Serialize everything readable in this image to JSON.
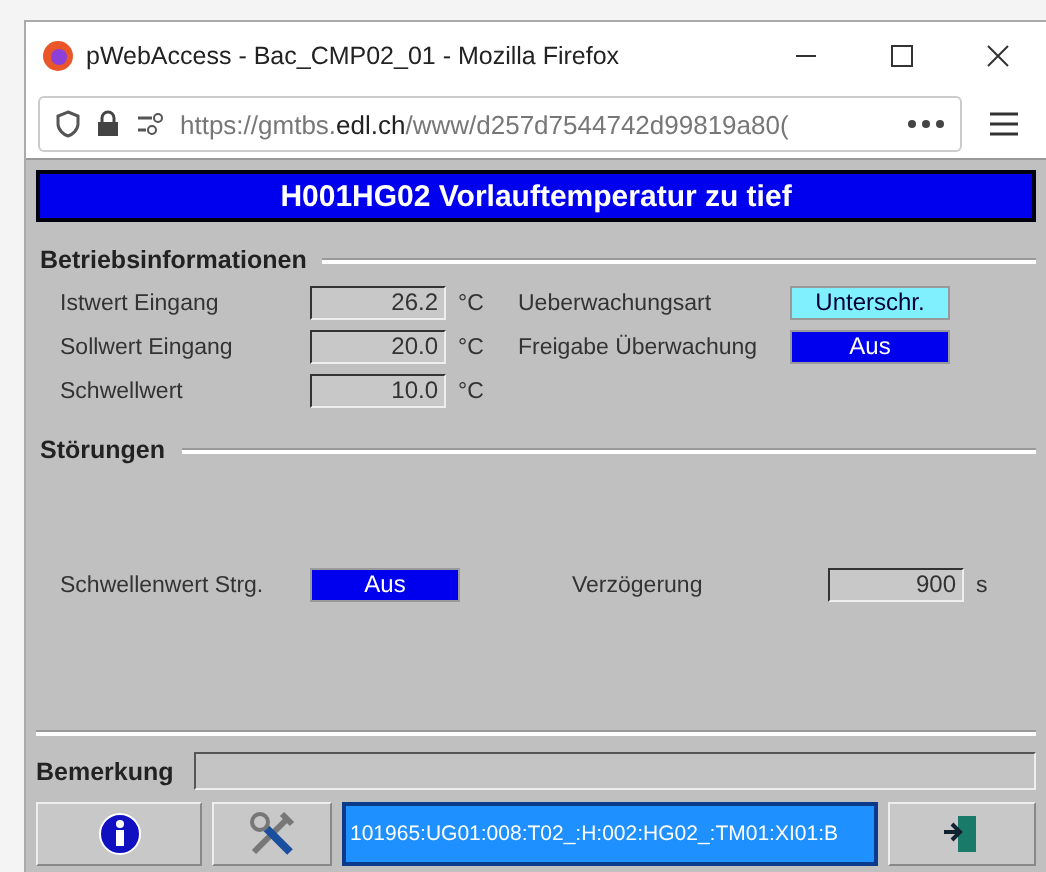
{
  "window": {
    "title": "pWebAccess - Bac_CMP02_01 - Mozilla Firefox"
  },
  "address_bar": {
    "url_prefix": "https://gmtbs.",
    "url_domain": "edl.ch",
    "url_rest": "/www/d257d7544742d99819a80("
  },
  "header": {
    "title": "H001HG02 Vorlauftemperatur zu tief"
  },
  "betriebsinformationen": {
    "title": "Betriebsinformationen",
    "values": [
      {
        "label": "Istwert Eingang",
        "value": "26.2",
        "unit": "°C"
      },
      {
        "label": "Sollwert Eingang",
        "value": "20.0",
        "unit": "°C"
      },
      {
        "label": "Schwellwert",
        "value": "10.0",
        "unit": "°C"
      }
    ],
    "states": [
      {
        "label": "Ueberwachungsart",
        "value": "Unterschr.",
        "color": "#80f0ff"
      },
      {
        "label": "Freigabe Überwachung",
        "value": "Aus",
        "color": "#0000ee"
      }
    ]
  },
  "stoerungen": {
    "title": "Störungen",
    "schwellenwert": {
      "label": "Schwellenwert Strg.",
      "value": "Aus",
      "color": "#0000ee"
    },
    "verzoegerung": {
      "label": "Verzögerung",
      "value": "900",
      "unit": "s"
    }
  },
  "bemerkung": {
    "label": "Bemerkung"
  },
  "footer": {
    "address": "101965:UG01:008:T02_:H:002:HG02_:TM01:XI01:B"
  }
}
